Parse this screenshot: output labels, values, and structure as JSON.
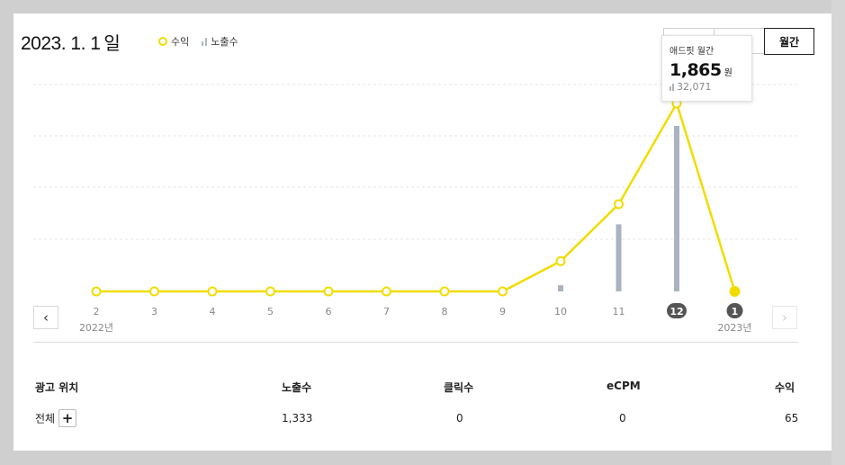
{
  "header": {
    "date": "2023. 1. 1",
    "date_unit": "일",
    "legend_revenue": "수익",
    "legend_impressions": "노출수",
    "period_button": "월간"
  },
  "tooltip": {
    "title": "애드핏 월간",
    "value": "1,865",
    "unit": "원",
    "impressions": "32,071"
  },
  "chart_data": {
    "type": "line",
    "categories": [
      "2",
      "3",
      "4",
      "5",
      "6",
      "7",
      "8",
      "9",
      "10",
      "11",
      "12",
      "1"
    ],
    "year_labels": {
      "start": "2022년",
      "end": "2023년"
    },
    "highlighted": [
      "12",
      "1"
    ],
    "series": [
      {
        "name": "수익",
        "values": [
          0,
          0,
          0,
          0,
          0,
          0,
          0,
          0,
          450,
          1300,
          2800,
          0
        ]
      },
      {
        "name": "노출수",
        "values": [
          0,
          0,
          0,
          0,
          0,
          0,
          0,
          0,
          1200,
          13000,
          32071,
          0
        ]
      }
    ],
    "grid": true,
    "colors": {
      "line": "#f2dc00",
      "bar": "#aab3be",
      "grid": "#e6e6e6"
    }
  },
  "table": {
    "headers": [
      "광고 위치",
      "노출수",
      "클릭수",
      "eCPM",
      "수익"
    ],
    "row": {
      "label": "전체",
      "expand": "+",
      "values": [
        "1,333",
        "0",
        "0",
        "65"
      ]
    }
  },
  "nav": {
    "prev": "‹",
    "next": "›"
  }
}
